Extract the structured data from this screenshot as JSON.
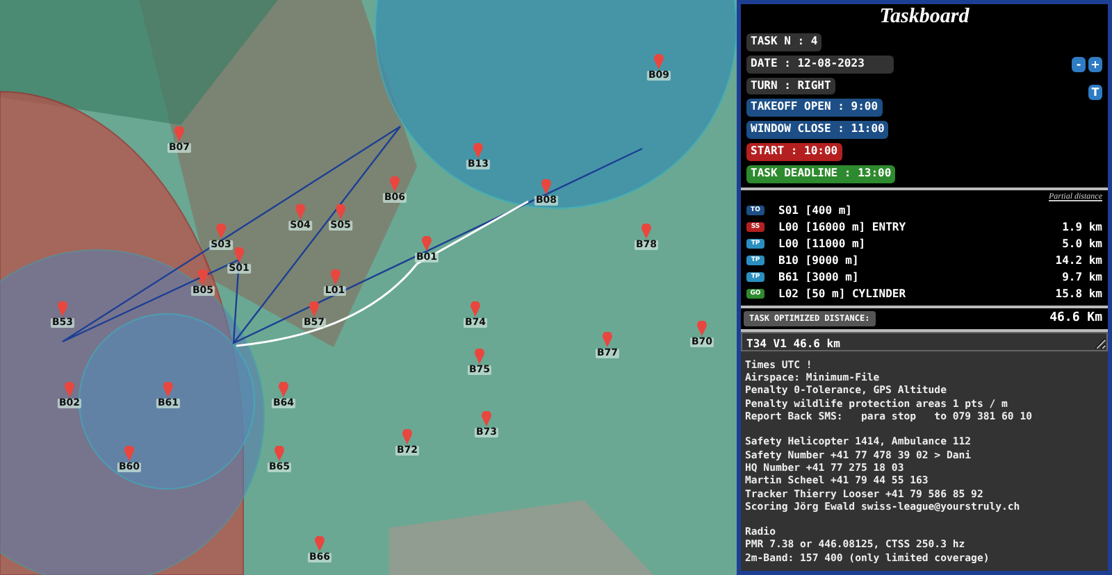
{
  "map": {
    "waypoints": [
      {
        "name": "B09"
      },
      {
        "name": "B07"
      },
      {
        "name": "B13"
      },
      {
        "name": "B06"
      },
      {
        "name": "B08"
      },
      {
        "name": "S04"
      },
      {
        "name": "S05"
      },
      {
        "name": "S03"
      },
      {
        "name": "B78"
      },
      {
        "name": "B01"
      },
      {
        "name": "S01"
      },
      {
        "name": "B05"
      },
      {
        "name": "L01"
      },
      {
        "name": "B53"
      },
      {
        "name": "B57"
      },
      {
        "name": "B74"
      },
      {
        "name": "B70"
      },
      {
        "name": "B77"
      },
      {
        "name": "B75"
      },
      {
        "name": "B02"
      },
      {
        "name": "B61"
      },
      {
        "name": "B64"
      },
      {
        "name": "B73"
      },
      {
        "name": "B72"
      },
      {
        "name": "B60"
      },
      {
        "name": "B65"
      },
      {
        "name": "B66"
      }
    ]
  },
  "panel": {
    "title": "Taskboard",
    "fields": [
      {
        "text": "TASK N : 4",
        "kind": "plain"
      },
      {
        "text": "DATE : 12-08-2023",
        "kind": "wide"
      },
      {
        "text": "TURN : RIGHT",
        "kind": "plain"
      },
      {
        "text": "TAKEOFF OPEN : 9:00",
        "kind": "blue"
      },
      {
        "text": "WINDOW CLOSE : 11:00",
        "kind": "blue"
      },
      {
        "text": "START : 10:00",
        "kind": "red"
      },
      {
        "text": "TASK DEADLINE : 13:00",
        "kind": "green"
      }
    ],
    "counter_buttons": [
      "-",
      "+"
    ],
    "turn_button": "T"
  },
  "waypoints": {
    "header": "Partial distance",
    "items": [
      {
        "type": "TO",
        "name": "S01 [400 m]"
      },
      {
        "type": "SS",
        "name": "L00 [16000 m] ENTRY",
        "distance": "1.9 km"
      },
      {
        "type": "TP",
        "name": "L00 [11000 m]",
        "distance": "5.0 km"
      },
      {
        "type": "TP",
        "name": "B10 [9000 m]",
        "distance": "14.2 km"
      },
      {
        "type": "TP",
        "name": "B61 [3000 m]",
        "distance": "9.7 km"
      },
      {
        "type": "GO",
        "name": "L02 [50 m] CYLINDER",
        "distance": "15.8 km"
      }
    ]
  },
  "optimized": {
    "label": "TASK OPTIMIZED DISTANCE:",
    "value": "46.6 Km"
  },
  "notes": {
    "value": "T34 V1 46.6 km"
  },
  "info": [
    [
      "Times UTC !",
      "Airspace: Minimum-File",
      "Penalty 0-Tolerance, GPS Altitude",
      "Penalty wildlife protection areas 1 pts / m",
      "Report Back SMS:   para stop   to 079 381 60 10"
    ],
    [
      "Safety Helicopter 1414, Ambulance 112",
      "Safety Number +41 77 478 39 02 > Dani",
      "HQ Number +41 77 275 18 03",
      "Martin Scheel +41 79 44 55 163",
      "Tracker Thierry Looser +41 79 586 85 92",
      "Scoring Jörg Ewald swiss-league@yourstruly.ch"
    ],
    [
      "Radio",
      "PMR 7.38 or 446.08125, CTSS 250.3 hz",
      "2m-Band: 157 400 (only limited coverage)"
    ]
  ]
}
